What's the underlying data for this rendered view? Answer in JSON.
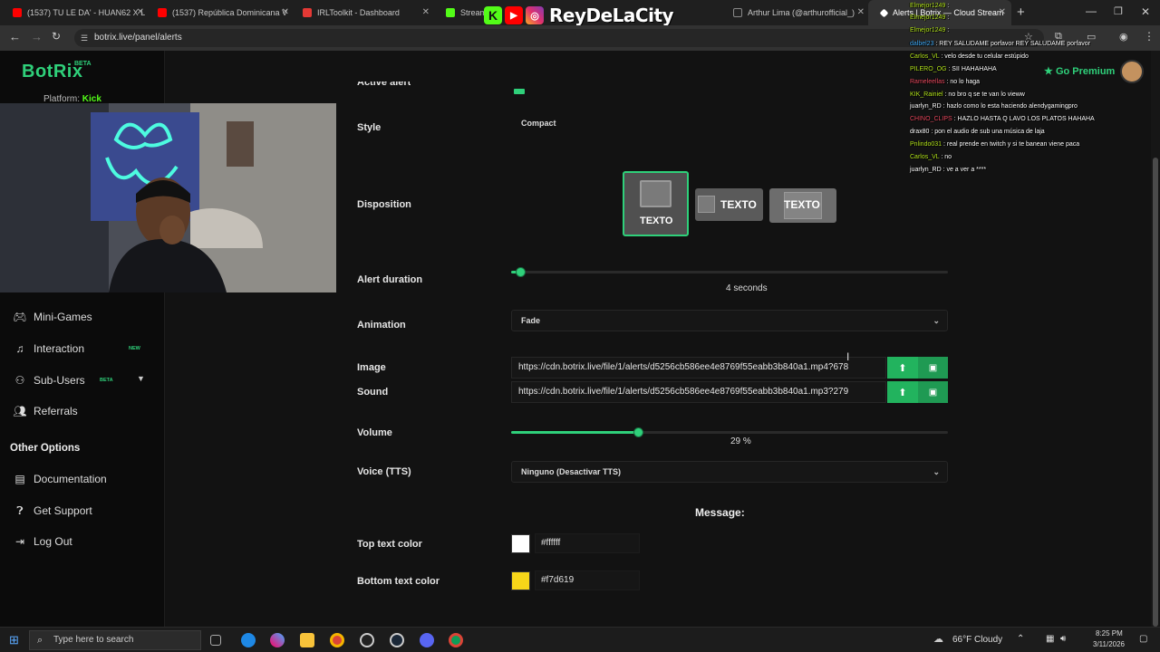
{
  "browser": {
    "tabs": [
      {
        "label": "(1537) TU LE DA' - HUAN62 X L",
        "color": "#ff0000"
      },
      {
        "label": "(1537) República Dominicana V",
        "color": "#ff0000"
      },
      {
        "label": "IRLToolkit - Dashboard",
        "color": "#e53935"
      },
      {
        "label": "Stream",
        "color": "#53fc18"
      },
      {
        "label": "Arthur Lima (@arthurofficial_)",
        "color": "#ffffff"
      },
      {
        "label": "Alerts | Botrix — Cloud Stream",
        "color": "#ffffff"
      }
    ],
    "url": "botrix.live/panel/alerts"
  },
  "overlay": {
    "title": "ReyDeLaCity"
  },
  "app": {
    "logo": "BotRix",
    "logo_badge": "BETA",
    "platform_label": "Platform:",
    "platform_value": "Kick",
    "premium": "Go Premium"
  },
  "sidebar": {
    "items": [
      {
        "label": "Mini-Games",
        "icon": "gamepad-icon"
      },
      {
        "label": "Interaction",
        "icon": "music-note-icon",
        "badge": "NEW"
      },
      {
        "label": "Sub-Users",
        "icon": "users-icon",
        "badge": "BETA"
      },
      {
        "label": "Referrals",
        "icon": "user-group-icon"
      }
    ],
    "other_options_title": "Other Options",
    "other_items": [
      {
        "label": "Documentation",
        "icon": "book-icon"
      },
      {
        "label": "Get Support",
        "icon": "help-icon"
      },
      {
        "label": "Log Out",
        "icon": "logout-icon"
      }
    ]
  },
  "form": {
    "active_alert_label": "Active alert",
    "style": {
      "label": "Style",
      "value": "Compact"
    },
    "disposition": {
      "label": "Disposition",
      "options": [
        "TEXTO",
        "TEXTO",
        "TEXTO"
      ],
      "selected": 0
    },
    "alert_duration": {
      "label": "Alert duration",
      "value": "4",
      "unit": "seconds",
      "fraction": 0.02
    },
    "animation": {
      "label": "Animation",
      "value": "Fade"
    },
    "image": {
      "label": "Image",
      "value": "https://cdn.botrix.live/file/1/alerts/d5256cb586ee4e8769f55eabb3b840a1.mp4?678"
    },
    "sound": {
      "label": "Sound",
      "value": "https://cdn.botrix.live/file/1/alerts/d5256cb586ee4e8769f55eabb3b840a1.mp3?279"
    },
    "volume": {
      "label": "Volume",
      "value": "29",
      "unit": "%",
      "fraction": 0.29
    },
    "voice": {
      "label": "Voice (TTS)",
      "value": "Ninguno (Desactivar TTS)"
    },
    "message_title": "Message:",
    "top_text_color": {
      "label": "Top text color",
      "value": "#ffffff"
    },
    "bottom_text_color": {
      "label": "Bottom text color",
      "value": "#f7d619"
    }
  },
  "chat": [
    {
      "user": "Elmejor1249",
      "text": ":",
      "color": "#b5e61d"
    },
    {
      "user": "Elmejor1249",
      "text": ":",
      "color": "#b5e61d"
    },
    {
      "user": "Elmejor1249",
      "text": ":",
      "color": "#b5e61d"
    },
    {
      "user": "dalbel23",
      "text": ": REY SALUDAME porfavor REY SALUDAME porfavor",
      "color": "#3fa9f5"
    },
    {
      "user": "Carlos_VL",
      "text": ": velo desde tu celular estúpido",
      "color": "#b5e61d"
    },
    {
      "user": "PILERO_OG",
      "text": ": SII HAHAHAHA",
      "color": "#b5e61d"
    },
    {
      "user": "Rameleellas",
      "text": ": no lo haga",
      "color": "#e84a5f"
    },
    {
      "user": "KIK_Rainiel",
      "text": ": no bro q se te van lo vieww",
      "color": "#b5e61d"
    },
    {
      "user": "juarlyn_RD",
      "text": ": hazlo como lo esta haciendo alendygamingpro",
      "color": "#ffffff"
    },
    {
      "user": "CHINO_CLIPS",
      "text": ": HAZLO HASTA Q LAVO LOS PLATOS HAHAHA",
      "color": "#e84a5f"
    },
    {
      "user": "drax80",
      "text": ": pon el audio de sub una música de laja",
      "color": "#ffffff"
    },
    {
      "user": "Pnlindo031",
      "text": ": real prende en twitch y si te banean viene paca",
      "color": "#b5e61d"
    },
    {
      "user": "Carlos_VL",
      "text": ": no",
      "color": "#b5e61d"
    },
    {
      "user": "juarlyn_RD",
      "text": ": ve a ver a ****",
      "color": "#ffffff"
    }
  ],
  "taskbar": {
    "search_placeholder": "Type here to search",
    "weather": "66°F  Cloudy",
    "time": "8:25 PM",
    "date": "3/11/2026"
  }
}
